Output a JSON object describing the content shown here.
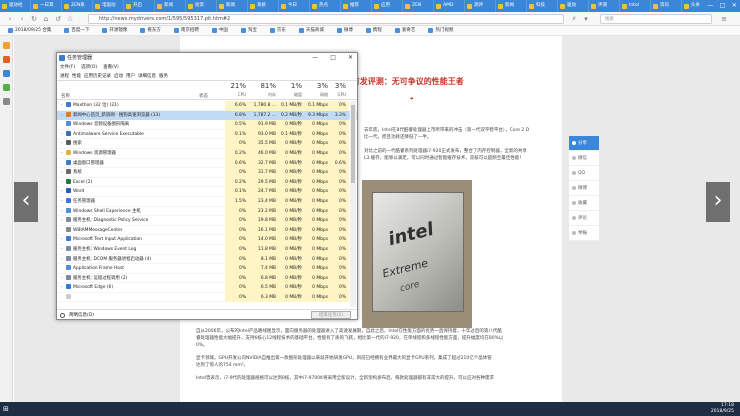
{
  "browser": {
    "tabs": [
      "驱动经",
      "一日耳",
      "ZEN系",
      "电驱动",
      "开启",
      "新闻",
      "投资",
      "新闻",
      "系统",
      "今日",
      "热点",
      "推荐",
      "应用",
      "ZEN",
      "AMD",
      "测评",
      "新闻",
      "科技",
      "驱动",
      "评测",
      "Intel",
      "资讯",
      "头条",
      "图片",
      "直播",
      "中关",
      "测试",
      "本站",
      "Intel"
    ],
    "active_tab_label": "Int",
    "window_controls": [
      "—",
      "□",
      "✕"
    ],
    "url": "http://news.mydrivers.com/1/595/595317.pit.htm#2",
    "search_placeholder": "搜索",
    "bookmarks": [
      "2018/09/25 合集",
      "百度一下",
      "开源镜像",
      "看东方",
      "南京招聘",
      "中国",
      "淘宝",
      "京东",
      "天猫商城",
      "微博",
      "携程",
      "爱奇艺",
      "热门视频"
    ],
    "colors": {
      "tabbar": "#3b86d6",
      "accent": "#3b86d6",
      "taskbar": "#1d2d44",
      "article_title": "#c0392b"
    }
  },
  "article": {
    "title": "0K首发评测：无可争议的性能王者",
    "body_lines": [
      "去年底，Intel在8代酷睿处理器上市所带来的冲击（第一代双平稳平台），Core 2 D",
      "比一代，而且功耗还降低了一半。",
      "对比之前的一代酷睿系列处理器i7-920正式发布，整合了内存控制器，全新的共享",
      "L3 缓存，能够以满足，可以同时通过智能缓存技术，双核可以超频至最佳性能！"
    ],
    "chip_text": {
      "line1": "intel",
      "line2": "Extreme",
      "line3": "core"
    },
    "bottom_lines": [
      "自从2006年，公布的Intel产品路线图显示，面向服务器的处理器进入了高速发展期，自此之后，Intel在性能方面的优势一直保持着，十年过后的第八代酷",
      "睿处理器性能大幅提升，支持6核心12线程技术的基础平台，性能有了质的飞跃，相比第一代的i7-920，在单线程和多线程性能方面，提升幅度均在80%以",
      "0%。",
      "显卡领域，GPU开发公司NVIDIA自推出第一款图形处理器以来就开始研发GPU，目前已经拥有业界最大的显卡GPU系列，集成了超过210亿个晶体管",
      "达到了惊人的754 mm²。",
      "Intel曾表示，i7-9代的处理器规格可以达到8核，其中i7-9700K将采用全新设计，全新架构发布后，每款处理器都有非常大的提升，可以应对各种需求"
    ],
    "right_panel": [
      "分享",
      "微信",
      "QQ",
      "微博",
      "收藏",
      "评论",
      "举报"
    ]
  },
  "taskbar": {
    "start_icon": "⊞",
    "time": "17:18",
    "date": "2018/9/25"
  },
  "taskmanager": {
    "title": "任务管理器",
    "controls": [
      "—",
      "□",
      "✕"
    ],
    "menu": [
      "文件(F)",
      "选项(O)",
      "查看(V)"
    ],
    "tabs": [
      "进程",
      "性能",
      "应用历史记录",
      "启动",
      "用户",
      "详细信息",
      "服务"
    ],
    "header": {
      "name": "名称",
      "status": "状态",
      "cpu_pct": "21%",
      "cpu": "CPU",
      "mem_pct": "81%",
      "mem": "内存",
      "disk_pct": "1%",
      "disk": "磁盘",
      "net_pct": "3%",
      "net": "网络",
      "gpu_pct": "3%",
      "gpu": "GPU"
    },
    "rows": [
      {
        "expand": "›",
        "name": "Maxthon (32 位) (21)",
        "status": "",
        "cpu": "6.6%",
        "mem": "1,780.8 ...",
        "disk": "0.1 MB/秒",
        "net": "0.1 Mbps",
        "gpu": "0%",
        "color": "#3c7bd0",
        "sel": false
      },
      {
        "expand": "›",
        "name": "新闻中心首页_新浪网 · 搜狗高速浏览器 (13)",
        "status": "",
        "cpu": "6.8%",
        "mem": "1,787.2 ...",
        "disk": "0.2 MB/秒",
        "net": "9.3 Mbps",
        "gpu": "3.3%",
        "color": "#e07b2a",
        "sel": true
      },
      {
        "expand": "",
        "name": "Windows 音频设备图形隔离",
        "status": "",
        "cpu": "0.5%",
        "mem": "91.9 MB",
        "disk": "0 MB/秒",
        "net": "0 Mbps",
        "gpu": "0%",
        "color": "#4a8fd8",
        "sel": false
      },
      {
        "expand": "›",
        "name": "Antimalware Service Executable",
        "status": "",
        "cpu": "0.1%",
        "mem": "93.0 MB",
        "disk": "0.1 MB/秒",
        "net": "0 Mbps",
        "gpu": "0%",
        "color": "#3b6fb8",
        "sel": false
      },
      {
        "expand": "›",
        "name": "搜索",
        "status": "",
        "cpu": "0%",
        "mem": "35.5 MB",
        "disk": "0 MB/秒",
        "net": "0 Mbps",
        "gpu": "0%",
        "color": "#5a5a5a",
        "sel": false
      },
      {
        "expand": "›",
        "name": "Windows 资源管理器",
        "status": "",
        "cpu": "0.2%",
        "mem": "46.0 MB",
        "disk": "0 MB/秒",
        "net": "0 Mbps",
        "gpu": "0%",
        "color": "#e6b333",
        "sel": false
      },
      {
        "expand": "",
        "name": "桌面窗口管理器",
        "status": "",
        "cpu": "0.6%",
        "mem": "32.7 MB",
        "disk": "0 MB/秒",
        "net": "0 Mbps",
        "gpu": "0.6%",
        "color": "#3c7bd0",
        "sel": false
      },
      {
        "expand": "›",
        "name": "系统",
        "status": "",
        "cpu": "0%",
        "mem": "31.7 MB",
        "disk": "0 MB/秒",
        "net": "0 Mbps",
        "gpu": "0%",
        "color": "#6a6a6a",
        "sel": false
      },
      {
        "expand": "›",
        "name": "Excel (2)",
        "status": "",
        "cpu": "0.2%",
        "mem": "29.5 MB",
        "disk": "0 MB/秒",
        "net": "0 Mbps",
        "gpu": "0%",
        "color": "#1f7a3f",
        "sel": false
      },
      {
        "expand": "›",
        "name": "Word",
        "status": "",
        "cpu": "0.1%",
        "mem": "24.7 MB",
        "disk": "0 MB/秒",
        "net": "0 Mbps",
        "gpu": "0%",
        "color": "#2b5fb3",
        "sel": false
      },
      {
        "expand": "›",
        "name": "任务管理器",
        "status": "",
        "cpu": "1.5%",
        "mem": "23.4 MB",
        "disk": "0 MB/秒",
        "net": "0 Mbps",
        "gpu": "0%",
        "color": "#3c7bd0",
        "sel": false
      },
      {
        "expand": "›",
        "name": "Windows Shell Experience 主机",
        "status": "",
        "cpu": "0%",
        "mem": "23.2 MB",
        "disk": "0 MB/秒",
        "net": "0 Mbps",
        "gpu": "0%",
        "color": "#4a8fd8",
        "sel": false
      },
      {
        "expand": "›",
        "name": "服务主机: Diagnostic Policy Service",
        "status": "",
        "cpu": "0%",
        "mem": "19.8 MB",
        "disk": "0 MB/秒",
        "net": "0 Mbps",
        "gpu": "0%",
        "color": "#7a8aa0",
        "sel": false
      },
      {
        "expand": "",
        "name": "WBIAMMessageCenter",
        "status": "",
        "cpu": "0%",
        "mem": "16.1 MB",
        "disk": "0 MB/秒",
        "net": "0 Mbps",
        "gpu": "0%",
        "color": "#888888",
        "sel": false
      },
      {
        "expand": "›",
        "name": "Microsoft Text Input Application",
        "status": "",
        "cpu": "0%",
        "mem": "14.0 MB",
        "disk": "0 MB/秒",
        "net": "0 Mbps",
        "gpu": "0%",
        "color": "#3c7bd0",
        "sel": false
      },
      {
        "expand": "›",
        "name": "服务主机: Windows Event Log",
        "status": "",
        "cpu": "0%",
        "mem": "11.8 MB",
        "disk": "0 MB/秒",
        "net": "0 Mbps",
        "gpu": "0%",
        "color": "#7a8aa0",
        "sel": false
      },
      {
        "expand": "›",
        "name": "服务主机: DCOM 服务器进程启动器 (4)",
        "status": "",
        "cpu": "0%",
        "mem": "8.1 MB",
        "disk": "0 MB/秒",
        "net": "0 Mbps",
        "gpu": "0%",
        "color": "#7a8aa0",
        "sel": false
      },
      {
        "expand": "",
        "name": "Application Frame Host",
        "status": "",
        "cpu": "0%",
        "mem": "7.4 MB",
        "disk": "0 MB/秒",
        "net": "0 Mbps",
        "gpu": "0%",
        "color": "#4a8fd8",
        "sel": false
      },
      {
        "expand": "›",
        "name": "服务主机: 远程过程调用 (2)",
        "status": "",
        "cpu": "0%",
        "mem": "6.8 MB",
        "disk": "0 MB/秒",
        "net": "0 Mbps",
        "gpu": "0%",
        "color": "#7a8aa0",
        "sel": false
      },
      {
        "expand": "›",
        "name": "Microsoft Edge (6)",
        "status": "",
        "cpu": "0%",
        "mem": "6.5 MB",
        "disk": "0 MB/秒",
        "net": "0 Mbps",
        "gpu": "0%",
        "color": "#2b7cd3",
        "sel": false
      },
      {
        "expand": "",
        "name": "",
        "status": "",
        "cpu": "0%",
        "mem": "6.3 MB",
        "disk": "0 MB/秒",
        "net": "0 Mbps",
        "gpu": "0%",
        "color": "#cccccc",
        "sel": false
      }
    ],
    "footer_label": "简略信息(D)",
    "end_task_label": "结束任务(E)"
  }
}
